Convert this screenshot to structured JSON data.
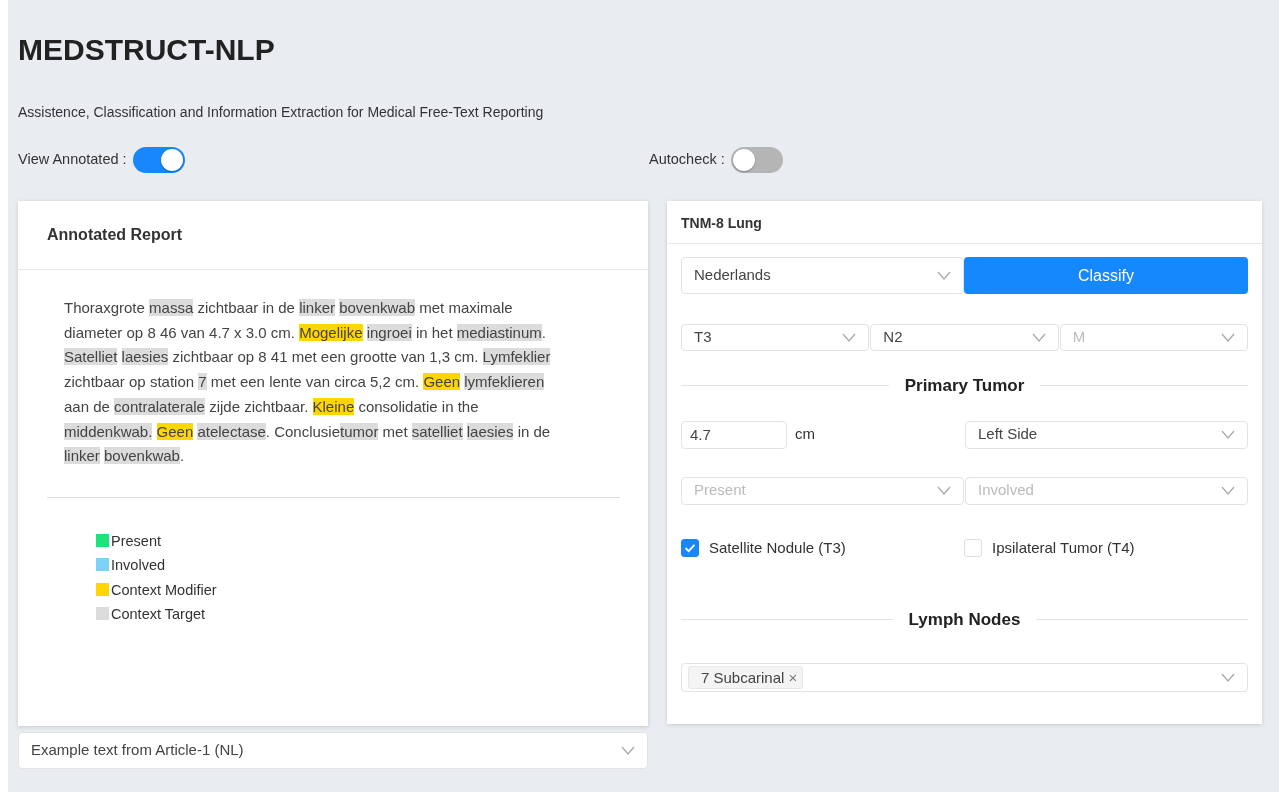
{
  "title": "MEDSTRUCT-NLP",
  "subtitle": "Assistence, Classification and Information Extraction for Medical Free-Text Reporting",
  "toggles": [
    {
      "label": "View Annotated",
      "separator": ":",
      "on": true
    },
    {
      "label": "Autocheck",
      "separator": ":",
      "on": false
    }
  ],
  "report": {
    "title": "Annotated Report",
    "segments": [
      {
        "text": "Thoraxgrote",
        "kind": "plain"
      },
      {
        "text": "massa",
        "kind": "target"
      },
      {
        "text": "zichtbaar in de",
        "kind": "plain"
      },
      {
        "text": "linker",
        "kind": "target"
      },
      {
        "text": "bovenkwab",
        "kind": "target"
      },
      {
        "text": "met maximale diameter op 8 46 van 4.7 x 3.0 cm.",
        "kind": "plain"
      },
      {
        "text": "Mogelijke",
        "kind": "modifier"
      },
      {
        "text": "ingroei",
        "kind": "target"
      },
      {
        "text": "in het",
        "kind": "plain"
      },
      {
        "text": "mediastinum",
        "kind": "target"
      },
      {
        "text": ".",
        "kind": "plain",
        "joined": true
      },
      {
        "text": "Satelliet",
        "kind": "target"
      },
      {
        "text": "laesies",
        "kind": "target"
      },
      {
        "text": "zichtbaar op 8 41 met een grootte van 1,3 cm.",
        "kind": "plain"
      },
      {
        "text": "Lymfeklier",
        "kind": "target"
      },
      {
        "text": "zichtbaar op station",
        "kind": "plain"
      },
      {
        "text": "7",
        "kind": "target"
      },
      {
        "text": "met een lente van circa 5,2 cm.",
        "kind": "plain"
      },
      {
        "text": "Geen",
        "kind": "modifier"
      },
      {
        "text": "lymfeklieren",
        "kind": "target"
      },
      {
        "text": "aan de",
        "kind": "plain"
      },
      {
        "text": "contralaterale",
        "kind": "target"
      },
      {
        "text": "zijde zichtbaar.",
        "kind": "plain"
      },
      {
        "text": "Kleine",
        "kind": "modifier"
      },
      {
        "text": "consolidatie in the",
        "kind": "plain"
      },
      {
        "text": "middenkwab.",
        "kind": "target"
      },
      {
        "text": "Geen",
        "kind": "modifier"
      },
      {
        "text": "atelectase",
        "kind": "target"
      },
      {
        "text": ". Conclusie",
        "kind": "plain",
        "joined": true
      },
      {
        "text": "tumor",
        "kind": "target",
        "joined": true
      },
      {
        "text": "met",
        "kind": "plain"
      },
      {
        "text": "satelliet",
        "kind": "target"
      },
      {
        "text": "laesies",
        "kind": "target"
      },
      {
        "text": "in de",
        "kind": "plain"
      },
      {
        "text": "linker",
        "kind": "target"
      },
      {
        "text": "bovenkwab",
        "kind": "target"
      },
      {
        "text": ".",
        "kind": "plain",
        "joined": true
      }
    ],
    "legend": [
      {
        "label": "Present",
        "color": "#1fe27a"
      },
      {
        "label": "Involved",
        "color": "#7dd3f7"
      },
      {
        "label": "Context Modifier",
        "color": "#ffd600"
      },
      {
        "label": "Context Target",
        "color": "#dcdcdc"
      }
    ]
  },
  "example_select": {
    "value": "Example text from Article-1 (NL)"
  },
  "tnm": {
    "title": "TNM-8 Lung",
    "language": {
      "value": "Nederlands"
    },
    "classify_button": "Classify",
    "stages": [
      {
        "value": "T3"
      },
      {
        "value": "N2"
      },
      {
        "placeholder": "M"
      }
    ],
    "primary_tumor": {
      "heading": "Primary Tumor",
      "size": {
        "value": "4.7",
        "unit": "cm"
      },
      "side": {
        "value": "Left Side"
      },
      "presence": {
        "placeholder": "Present"
      },
      "involvement": {
        "placeholder": "Involved"
      },
      "checks": [
        {
          "label": "Satellite Nodule (T3)",
          "checked": true
        },
        {
          "label": "Ipsilateral Tumor (T4)",
          "checked": false
        }
      ]
    },
    "lymph_nodes": {
      "heading": "Lymph Nodes",
      "tags": [
        {
          "label": "7 Subcarinal",
          "remove": "×"
        }
      ]
    }
  }
}
